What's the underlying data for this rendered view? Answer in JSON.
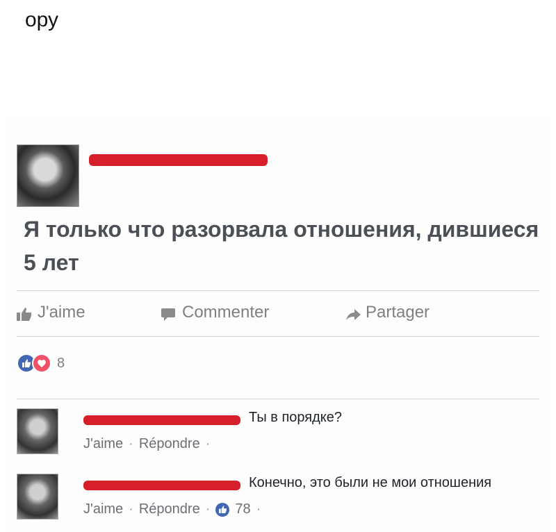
{
  "caption": "ору",
  "post": {
    "text": "Я только что разорвала отношения, дившиеся 5 лет"
  },
  "actions": {
    "like": "J'aime",
    "comment": "Commenter",
    "share": "Partager"
  },
  "reactions": {
    "count": "8"
  },
  "comments": [
    {
      "text": "Ты в порядке?",
      "like": "J'aime",
      "reply": "Répondre"
    },
    {
      "text": "Конечно, это были не мои отношения",
      "like": "J'aime",
      "reply": "Répondre",
      "likes": "78"
    }
  ],
  "colors": {
    "redaction": "#d71f2c",
    "like_blue": "#4267b2",
    "love_red": "#f25268"
  }
}
